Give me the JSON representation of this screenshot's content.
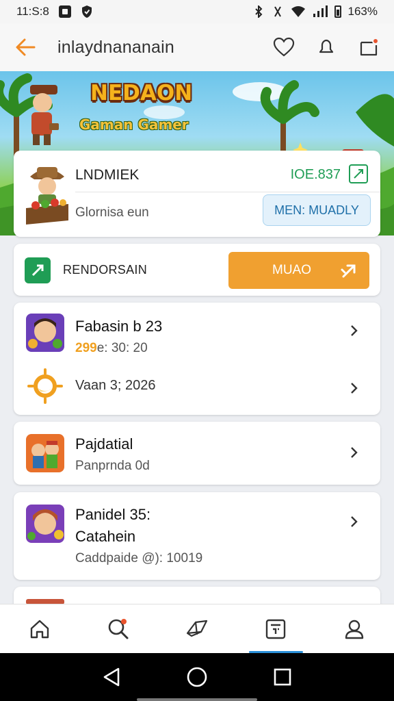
{
  "status_bar": {
    "time": "11:S:8",
    "battery": "163%"
  },
  "app_bar": {
    "title": "inlaydnananain"
  },
  "banner": {
    "logo_title": "NEDAON",
    "logo_subtitle": "Gaman Gamer"
  },
  "profile": {
    "name": "LNDMIEK",
    "subtitle": "Glornisa eun",
    "code": "IOE.837",
    "action_label": "MEN: MUADLY"
  },
  "recommend": {
    "label": "RENDORSAIN",
    "button_label": "MUAO"
  },
  "list": [
    {
      "title": "Fabasin b 23",
      "highlight": "299",
      "detail": "e: 30: 20"
    },
    {
      "title": "Vaan 3; 2026",
      "highlight": "",
      "detail": ""
    },
    {
      "title": "Pajdatial",
      "highlight": "",
      "detail": "Panprnda 0d"
    },
    {
      "title": "Panidel 35:",
      "title2": "Catahein",
      "highlight": "",
      "detail": "Caddpaide @): 10019"
    }
  ],
  "colors": {
    "accent_orange": "#f0a030",
    "accent_green": "#1f9d55",
    "accent_blue": "#2a8fd8"
  },
  "icons": [
    "back-arrow-icon",
    "heart-icon",
    "bell-icon",
    "notifications-icon",
    "edit-icon",
    "tag-icon",
    "share-icon",
    "chevron-right-icon",
    "home-icon",
    "search-icon",
    "games-icon",
    "calendar-icon",
    "profile-icon"
  ]
}
